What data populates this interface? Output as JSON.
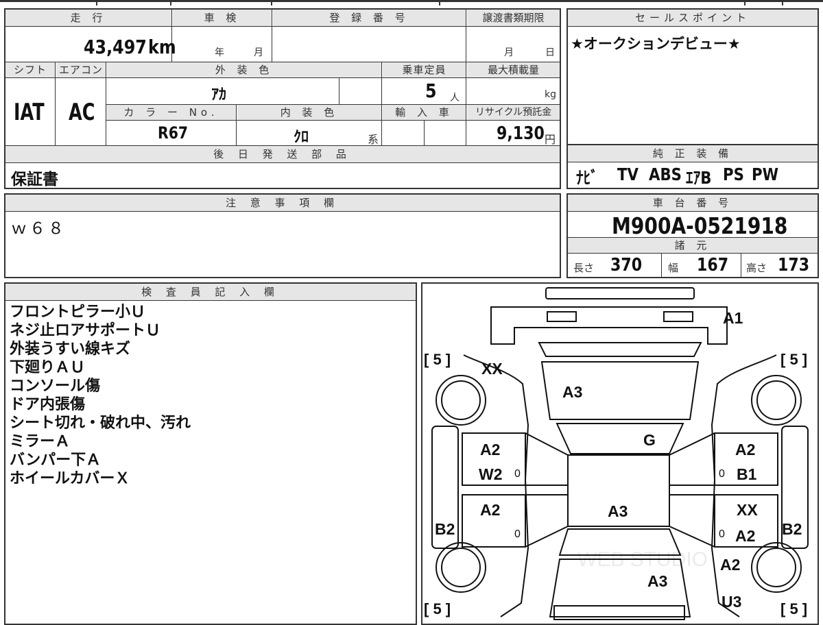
{
  "top_strip": {
    "cut_text": "…"
  },
  "vehicle": {
    "mileage_label": "走 行",
    "mileage": "43,497",
    "mileage_unit": "km",
    "shaken_label": "車 検",
    "shaken_year": "年",
    "shaken_month": "月",
    "registration_label": "登 録 番 号",
    "transfer_label": "譲渡書類期限",
    "transfer_month": "月",
    "transfer_day": "日",
    "shift_label": "シフト",
    "shift": "IAT",
    "ac_label": "エアコン",
    "ac": "AC",
    "exterior_color_label": "外 装 色",
    "exterior_color": "ｱｶ",
    "capacity_label": "乗車定員",
    "capacity": "5",
    "capacity_unit": "人",
    "max_load_label": "最大積載量",
    "max_load_unit": "kg",
    "color_no_label": "カ ラ ー No.",
    "color_no": "R67",
    "interior_color_label": "内 装 色",
    "interior_color": "ｸﾛ",
    "interior_suffix": "系",
    "import_label": "輸 入 車",
    "recycle_label": "リサイクル預託金",
    "recycle_fee": "9,130",
    "recycle_unit": "円"
  },
  "sales_point": {
    "label": "セールスポイント",
    "text": "★オークションデビュー★"
  },
  "later_parts": {
    "label": "後 日 発 送 部 品",
    "text": "保証書"
  },
  "genuine_equipment": {
    "label": "純 正 装 備",
    "items": [
      "ﾅﾋﾞ",
      "TV",
      "ABS",
      "ｴｱB",
      "PS",
      "PW"
    ]
  },
  "notes": {
    "label": "注 意 事 項 欄",
    "text": "ｗ６８"
  },
  "chassis": {
    "label": "車 台 番 号",
    "number": "M900A-0521918"
  },
  "specs": {
    "label": "諸 元",
    "length_label": "長さ",
    "length": "370",
    "width_label": "幅",
    "width": "167",
    "height_label": "高さ",
    "height": "173"
  },
  "inspector": {
    "label": "検 査 員 記 入 欄",
    "remarks": [
      "フロントピラー小Ｕ",
      "ネジ止ロアサポートＵ",
      "外装うすい線キズ",
      "下廻りＡＵ",
      "コンソール傷",
      "ドア内張傷",
      "シート切れ・破れ中、汚れ",
      "ミラーＡ",
      "バンパー下Ａ",
      "ホイールカバーＸ"
    ]
  },
  "diagram": {
    "tire_tl": "[ 5 ]",
    "tire_tr": "[ 5 ]",
    "tire_bl": "[ 5 ]",
    "tire_br": "[ 5 ]",
    "front_bumper": "A1",
    "hood_left": "XX",
    "hood": "A3",
    "windshield": "G",
    "fl_door_1": "A2",
    "fl_door_2": "W2",
    "fr_door_1": "A2",
    "fr_door_2": "B1",
    "rl_door": "A2",
    "rr_door_1": "XX",
    "rr_door_2": "A2",
    "roof": "A3",
    "left_panel": "B2",
    "right_panel": "B2",
    "rear_right_quarter": "A2",
    "trunk": "A3",
    "rear_bumper": "U3",
    "marks": [
      "0",
      "0",
      "0",
      "0"
    ],
    "watermark": "WEB STUDIO"
  }
}
